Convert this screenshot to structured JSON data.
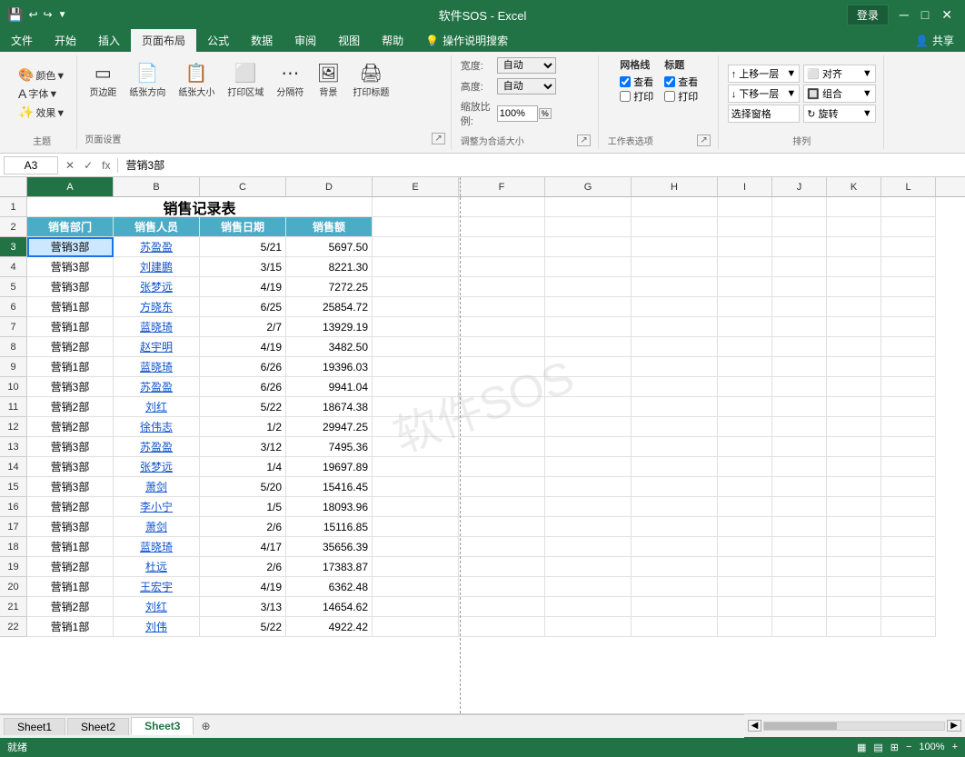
{
  "titleBar": {
    "appName": "软件SOS - Excel",
    "loginBtn": "登录",
    "quickAccess": [
      "💾",
      "↩",
      "↪",
      "▼"
    ]
  },
  "ribbonTabs": [
    "文件",
    "开始",
    "插入",
    "页面布局",
    "公式",
    "数据",
    "审阅",
    "视图",
    "帮助",
    "💡 操作说明搜索"
  ],
  "activeTab": "页面布局",
  "ribbonGroups": {
    "theme": {
      "label": "主题",
      "buttons": [
        "颜色▼",
        "字体▼",
        "效果▼"
      ]
    },
    "pageSetup": {
      "label": "页面设置",
      "buttons": [
        "页边距",
        "纸张方向",
        "纸张大小",
        "打印区域",
        "分隔符",
        "背景",
        "打印标题"
      ]
    },
    "scaleToFit": {
      "label": "调整为合适大小",
      "width": "自动",
      "height": "自动",
      "scale": "100%"
    },
    "sheetOptions": {
      "label": "工作表选项",
      "gridlines": {
        "view": true,
        "print": false
      },
      "headings": {
        "view": true,
        "print": false
      }
    },
    "arrange": {
      "label": "排列",
      "buttons": [
        "上移一层▼",
        "对齐▼",
        "下移一层▼",
        "组合▼",
        "选择窗格",
        "旋转▼"
      ]
    }
  },
  "formulaBar": {
    "cellRef": "A3",
    "formula": "营销3部"
  },
  "columns": {
    "widths": [
      30,
      95,
      95,
      95,
      95,
      95,
      95,
      95,
      95,
      95,
      95,
      95
    ],
    "labels": [
      "",
      "A",
      "B",
      "C",
      "D",
      "E",
      "F",
      "G",
      "H",
      "I",
      "J",
      "K",
      "L"
    ]
  },
  "spreadsheet": {
    "title": "销售记录表",
    "headers": [
      "销售部门",
      "销售人员",
      "销售日期",
      "销售额"
    ],
    "rows": [
      [
        "营销3部",
        "苏盈盈",
        "5/21",
        "5697.50"
      ],
      [
        "营销3部",
        "刘建鹏",
        "3/15",
        "8221.30"
      ],
      [
        "营销3部",
        "张梦远",
        "4/19",
        "7272.25"
      ],
      [
        "营销1部",
        "方晓东",
        "6/25",
        "25854.72"
      ],
      [
        "营销1部",
        "蓝晓琦",
        "2/7",
        "13929.19"
      ],
      [
        "营销2部",
        "赵宇明",
        "4/19",
        "3482.50"
      ],
      [
        "营销1部",
        "蓝晓琦",
        "6/26",
        "19396.03"
      ],
      [
        "营销3部",
        "苏盈盈",
        "6/26",
        "9941.04"
      ],
      [
        "营销2部",
        "刘红",
        "5/22",
        "18674.38"
      ],
      [
        "营销2部",
        "徐伟志",
        "1/2",
        "29947.25"
      ],
      [
        "营销3部",
        "苏盈盈",
        "3/12",
        "7495.36"
      ],
      [
        "营销3部",
        "张梦远",
        "1/4",
        "19697.89"
      ],
      [
        "营销3部",
        "萧剑",
        "5/20",
        "15416.45"
      ],
      [
        "营销2部",
        "李小宁",
        "1/5",
        "18093.96"
      ],
      [
        "营销3部",
        "萧剑",
        "2/6",
        "15116.85"
      ],
      [
        "营销1部",
        "蓝晓琦",
        "4/17",
        "35656.39"
      ],
      [
        "营销2部",
        "杜远",
        "2/6",
        "17383.87"
      ],
      [
        "营销1部",
        "王宏宇",
        "4/19",
        "6362.48"
      ],
      [
        "营销2部",
        "刘红",
        "3/13",
        "14654.62"
      ],
      [
        "营销1部",
        "刘伟",
        "5/22",
        "4922.42"
      ]
    ]
  },
  "sheetTabs": [
    "Sheet1",
    "Sheet2",
    "Sheet3"
  ],
  "activeSheet": "Sheet3",
  "statusBar": {
    "status": "就绪",
    "scrollInfo": "",
    "mode": ""
  }
}
